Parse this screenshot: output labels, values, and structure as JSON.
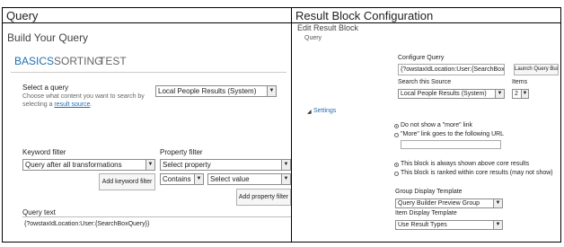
{
  "left": {
    "header": "Query",
    "panel_title": "Build Your Query",
    "tabs": [
      "BASICS",
      "SORTING",
      "TEST"
    ],
    "select_query": {
      "label": "Select a query",
      "desc_line1": "Choose what content you want to search by",
      "desc_line2_prefix": "selecting a ",
      "desc_link": "result source",
      "desc_suffix": ".",
      "value": "Local People Results (System)"
    },
    "keyword_filter": {
      "label": "Keyword filter",
      "value": "Query after all transformations",
      "button": "Add keyword filter"
    },
    "property_filter": {
      "label": "Property filter",
      "value": "Select property",
      "operator": "Contains",
      "value2": "Select value",
      "button": "Add property filter"
    },
    "query_text": {
      "label": "Query text",
      "value": "{?owstaxIdLocation:User:{SearchBoxQuery}}"
    }
  },
  "right": {
    "header": "Result Block Configuration",
    "subtitle": "Edit Result Block",
    "query_label": "Query",
    "configure_query": {
      "label": "Configure Query",
      "value": "{?owstaxIdLocation:User:{SearchBoxQuery}}",
      "button": "Launch Query Builder"
    },
    "search_source": {
      "label": "Search this Source",
      "value": "Local People Results (System)"
    },
    "items": {
      "label": "Items",
      "value": "2"
    },
    "settings_label": "Settings",
    "more_link": {
      "option1": "Do not show a \"more\" link",
      "option2": "\"More\" link goes to the following URL"
    },
    "rank": {
      "option1": "This block is always shown above core results",
      "option2": "This block is ranked within core results (may not show)"
    },
    "group_template": {
      "label": "Group Display Template",
      "value": "Query Builder Preview Group"
    },
    "item_template": {
      "label": "Item Display Template",
      "value": "Use Result Types"
    }
  },
  "colors": {
    "accent": "#1f6fb0",
    "tab_inactive": "#666666"
  }
}
